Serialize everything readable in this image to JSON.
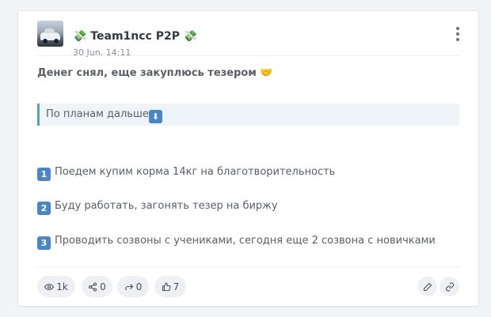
{
  "post": {
    "channel_title": "💸 Team1ncc P2P 💸",
    "date": "30 Jun, 14:11",
    "lead_text": "Денег снял, еще закуплюсь тезером 🤝",
    "quote_text": "По планам дальше",
    "quote_emoji": "⬇",
    "list": [
      {
        "num": "1",
        "text": "Поедем купим корма 14кг на благотворительность"
      },
      {
        "num": "2",
        "text": "Буду работать, загонять тезер на биржу"
      },
      {
        "num": "3",
        "text": "Проводить созвоны с учениками, сегодня еще 2 созвона с новичками"
      }
    ]
  },
  "stats": {
    "views": "1k",
    "shares": "0",
    "forwards": "0",
    "reactions": "7"
  },
  "icons": {
    "menu": "more-vertical-icon",
    "views": "eye-icon",
    "shares": "share-nodes-icon",
    "forwards": "forward-arrow-icon",
    "reactions": "thumbs-up-icon",
    "edit": "pencil-icon",
    "link": "link-icon"
  },
  "colors": {
    "quote_border": "#5ba3b8",
    "quote_bg": "#eef4f8",
    "number_badge": "#4a86c5"
  }
}
